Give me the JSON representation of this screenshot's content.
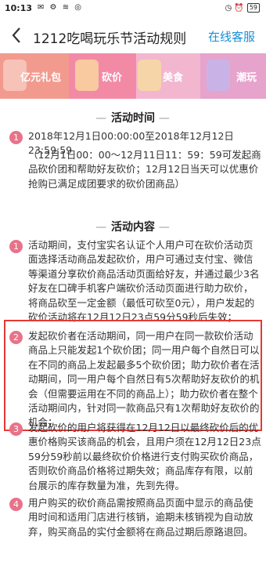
{
  "status": {
    "time": "10:13",
    "left_icons": "✉ ⚙ ≋ ◎",
    "right_icons": "◷ ⏰",
    "battery": "59"
  },
  "nav": {
    "title": "1212吃喝玩乐节活动规则",
    "service_label": "在线客服"
  },
  "banner": {
    "categories": [
      {
        "label": "亿元礼包",
        "color": "#f29a8e",
        "icon": "gift-icon"
      },
      {
        "label": "砍价",
        "color": "#f28aa6",
        "icon": "bowl-icon"
      },
      {
        "label": "美食",
        "color": "#f3b6cf",
        "icon": "food-icon"
      },
      {
        "label": "潮玩",
        "color": "#e6a3cc",
        "icon": "microphone-icon"
      }
    ]
  },
  "sections": {
    "time": {
      "dash": "—",
      "title": "活动时间",
      "item1": "2018年12月1日00:00:00至2018年12月12日23:59:59",
      "note": "（12月1日00：00～12月11日11：59：59可发起商品砍价团和帮助好友砍价；12月12日当天可以优惠价抢购已满足成团要求的砍价团商品）"
    },
    "content": {
      "dash": "—",
      "title": "活动内容",
      "items": [
        {
          "num": "1",
          "text": "活动期间，支付宝实名认证个人用户可在砍价活动页面选择活动商品发起砍价，用户可通过支付宝、微信等渠道分享砍价商品活动页面给好友，并通过最少3名好友在口碑手机客户端砍价活动页面进行助力砍价，将商品砍至一定金额（最低可砍至0元），用户发起的砍价活动将在12月12日23点59分59秒后失效；"
        },
        {
          "num": "2",
          "text": "发起砍价者在活动期间，同一用户在同一款砍价活动商品上只能发起1个砍价团；同一用户每个自然日可以在不同的商品上发起最多5个砍价团；助力砍价者在活动期间，同一用户每个自然日有5次帮助好友砍价的机会（但需要运用在不同的商品上）；助力砍价者在整个活动期间内，针对同一款商品只有1次帮助好友砍价的机会；"
        },
        {
          "num": "3",
          "text": "发起砍价的用户将获得在12月12日以最终砍价后的优惠价格购买该商品的机会，且用户须在12月12日23点59分59秒前以最终砍价价格进行支付购买砍价商品，否则砍价商品价格将过期失效；商品库存有限，以前台展示的库存数量为准，先到先得。"
        },
        {
          "num": "4",
          "text": "用户购买的砍价商品需按照商品页面中显示的商品使用时间和适用门店进行核销，逾期未核销视为自动放弃，购买商品的实付金额将在商品过期后原路退回。"
        }
      ]
    }
  }
}
